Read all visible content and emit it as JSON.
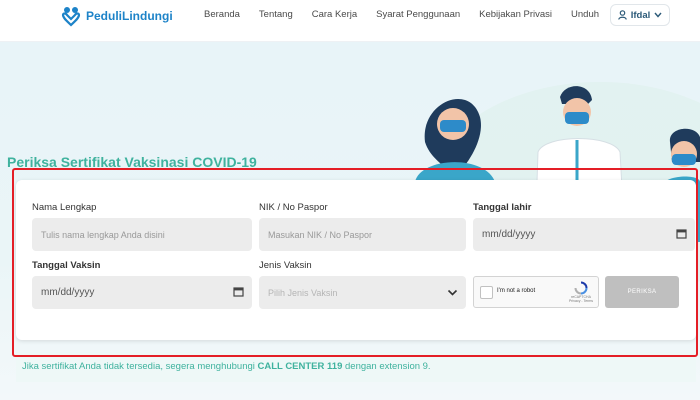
{
  "header": {
    "brand": "PeduliLindungi",
    "nav": [
      "Beranda",
      "Tentang",
      "Cara Kerja",
      "Syarat Penggunaan",
      "Kebijakan Privasi",
      "Unduh"
    ],
    "user_name": "Ifdal"
  },
  "hero": {
    "title": "Periksa Sertifikat Vaksinasi COVID-19"
  },
  "form": {
    "name_label": "Nama Lengkap",
    "name_placeholder": "Tulis nama lengkap Anda disini",
    "nik_label": "NIK / No Paspor",
    "nik_placeholder": "Masukan NIK / No Paspor",
    "dob_label": "Tanggal lahir",
    "dob_value": "mm/dd/yyyy",
    "vacc_date_label": "Tanggal Vaksin",
    "vacc_date_value": "mm/dd/yyyy",
    "vacc_type_label": "Jenis Vaksin",
    "vacc_type_placeholder": "Pilih Jenis Vaksin",
    "captcha_text": "I'm not a robot",
    "captcha_brand": "reCAPTCHA",
    "captcha_links": "Privacy - Terms",
    "submit_label": "PERIKSA"
  },
  "notice": {
    "prefix": "Jika sertifikat Anda tidak tersedia, segera menghubungi ",
    "highlight": "CALL CENTER 119",
    "suffix": " dengan extension 9."
  },
  "colors": {
    "brand": "#1d83c8",
    "accent": "#3fb29e",
    "highlight_frame": "#e41e26"
  }
}
